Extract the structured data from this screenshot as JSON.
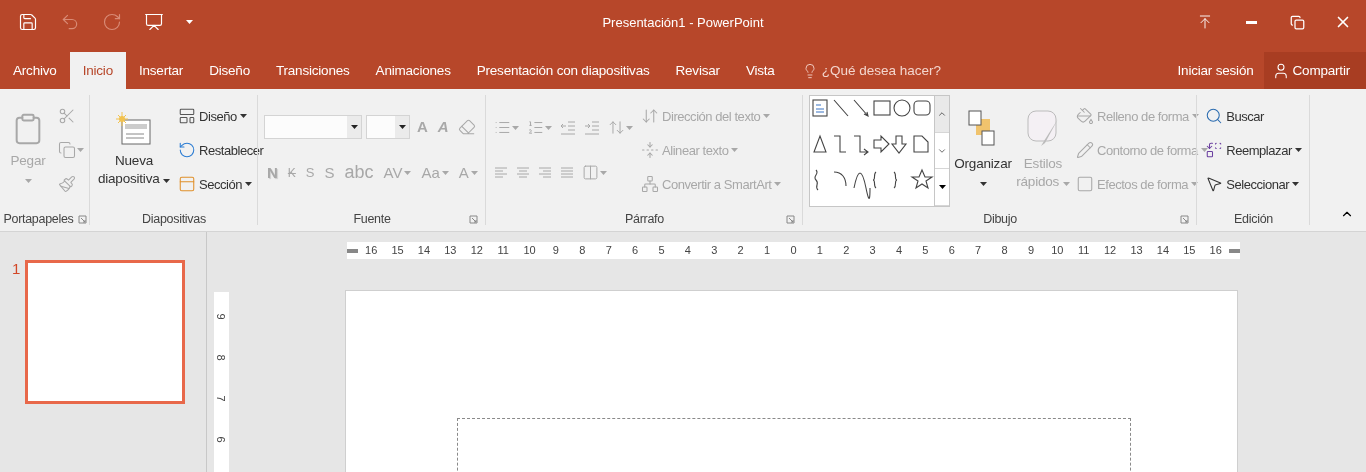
{
  "title_bar": {
    "title": "Presentación1 - PowerPoint",
    "quick_access": [
      {
        "disabled": false
      },
      {
        "disabled": true
      },
      {
        "disabled": true
      },
      {
        "disabled": false
      },
      {
        "disabled": false
      }
    ]
  },
  "menu_tabs": [
    {
      "label": "Archivo",
      "selected": false
    },
    {
      "label": "Inicio",
      "selected": true
    },
    {
      "label": "Insertar",
      "selected": false
    },
    {
      "label": "Diseño",
      "selected": false
    },
    {
      "label": "Transiciones",
      "selected": false
    },
    {
      "label": "Animaciones",
      "selected": false
    },
    {
      "label": "Presentación con diapositivas",
      "selected": false
    },
    {
      "label": "Revisar",
      "selected": false
    },
    {
      "label": "Vista",
      "selected": false
    }
  ],
  "tell_me": {
    "placeholder": "¿Qué desea hacer?"
  },
  "account": {
    "sign_in": "Iniciar sesión",
    "share": "Compartir"
  },
  "ribbon": {
    "groups": [
      {
        "kind": "clipboard",
        "name": "Portapapeles",
        "launcher": true,
        "columns": [
          [
            [
              {
                "kind": "large",
                "label": "Pegar",
                "dropdown": true,
                "disabled": true
              }
            ]
          ],
          [
            [
              {
                "kind": "icon",
                "dropdown": false,
                "disabled": true
              }
            ],
            [
              {
                "kind": "icon",
                "dropdown": true,
                "disabled": true
              }
            ],
            [
              {
                "kind": "icon",
                "dropdown": false,
                "disabled": true
              }
            ]
          ]
        ]
      },
      {
        "kind": "slides",
        "name": "Diapositivas",
        "launcher": false,
        "columns": [
          [
            [
              {
                "kind": "large",
                "label": "Nueva diapositiva",
                "dropdown": true,
                "disabled": false
              }
            ]
          ],
          [
            [
              {
                "kind": "small",
                "label": "Diseño",
                "dropdown": true,
                "disabled": false
              }
            ],
            [
              {
                "kind": "small",
                "label": "Restablecer",
                "dropdown": false,
                "disabled": false
              }
            ],
            [
              {
                "kind": "small",
                "label": "Sección",
                "dropdown": true,
                "disabled": false
              }
            ]
          ]
        ]
      },
      {
        "kind": "font",
        "name": "Fuente",
        "launcher": true,
        "columns": [
          [
            [
              {
                "kind": "combo",
                "dropdown": true,
                "disabled": true
              },
              {
                "kind": "combo",
                "dropdown": true,
                "disabled": true
              },
              {
                "kind": "glyph",
                "label": "A",
                "dropdown": false,
                "disabled": true
              },
              {
                "kind": "glyph",
                "label": "A",
                "dropdown": false,
                "disabled": true
              },
              {
                "kind": "icon",
                "dropdown": false,
                "disabled": true
              }
            ],
            [
              {
                "kind": "glyph",
                "label": "N",
                "dropdown": false,
                "disabled": true
              },
              {
                "kind": "glyph",
                "label": "K",
                "dropdown": false,
                "disabled": true
              },
              {
                "kind": "glyph",
                "label": "S",
                "dropdown": false,
                "disabled": true
              },
              {
                "kind": "glyph",
                "label": "S",
                "dropdown": false,
                "disabled": true
              },
              {
                "kind": "glyph",
                "label": "abc",
                "dropdown": false,
                "disabled": true
              },
              {
                "kind": "glyph",
                "label": "AV",
                "dropdown": true,
                "disabled": true
              },
              {
                "kind": "glyph",
                "label": "Aa",
                "dropdown": true,
                "disabled": true
              },
              {
                "kind": "glyph",
                "label": "A",
                "dropdown": true,
                "disabled": true
              }
            ]
          ]
        ]
      },
      {
        "kind": "paragraph",
        "name": "Párrafo",
        "launcher": true,
        "columns": [
          [
            [
              {
                "kind": "icon",
                "dropdown": true,
                "disabled": true
              },
              {
                "kind": "icon",
                "dropdown": true,
                "disabled": true
              },
              {
                "kind": "icon",
                "dropdown": false,
                "disabled": true
              },
              {
                "kind": "icon",
                "dropdown": false,
                "disabled": true
              },
              {
                "kind": "icon",
                "dropdown": true,
                "disabled": true
              }
            ],
            [
              {
                "kind": "icon",
                "dropdown": false,
                "disabled": true
              },
              {
                "kind": "icon",
                "dropdown": false,
                "disabled": true
              },
              {
                "kind": "icon",
                "dropdown": false,
                "disabled": true
              },
              {
                "kind": "icon",
                "dropdown": false,
                "disabled": true
              },
              {
                "kind": "icon",
                "dropdown": true,
                "disabled": true
              }
            ]
          ],
          [
            [
              {
                "kind": "small",
                "label": "Dirección del texto",
                "dropdown": true,
                "disabled": true
              }
            ],
            [
              {
                "kind": "small",
                "label": "Alinear texto",
                "dropdown": true,
                "disabled": true
              }
            ],
            [
              {
                "kind": "small",
                "label": "Convertir a SmartArt",
                "dropdown": true,
                "disabled": true
              }
            ]
          ]
        ]
      },
      {
        "kind": "drawing",
        "name": "Dibujo",
        "launcher": true,
        "columns": [
          [
            [
              {
                "kind": "gallery",
                "dropdown": true,
                "disabled": false
              }
            ]
          ],
          [
            [
              {
                "kind": "large",
                "label": "Organizar",
                "dropdown": true,
                "disabled": false
              }
            ]
          ],
          [
            [
              {
                "kind": "large",
                "label": "Estilos rápidos",
                "dropdown": true,
                "disabled": true
              }
            ]
          ],
          [
            [
              {
                "kind": "small",
                "label": "Relleno de forma",
                "dropdown": true,
                "disabled": true
              }
            ],
            [
              {
                "kind": "small",
                "label": "Contorno de forma",
                "dropdown": true,
                "disabled": true
              }
            ],
            [
              {
                "kind": "small",
                "label": "Efectos de forma",
                "dropdown": true,
                "disabled": true
              }
            ]
          ]
        ]
      },
      {
        "kind": "editing",
        "name": "Edición",
        "launcher": false,
        "columns": [
          [
            [
              {
                "kind": "small",
                "label": "Buscar",
                "dropdown": false,
                "disabled": false
              }
            ],
            [
              {
                "kind": "small",
                "label": "Reemplazar",
                "dropdown": true,
                "disabled": false
              }
            ],
            [
              {
                "kind": "small",
                "label": "Seleccionar",
                "dropdown": true,
                "disabled": false
              }
            ]
          ]
        ]
      }
    ]
  },
  "slides_pane": {
    "slides": [
      {
        "number": "1",
        "selected": true
      }
    ]
  },
  "rulers": {
    "horizontal": [
      "16",
      "15",
      "14",
      "13",
      "12",
      "11",
      "10",
      "9",
      "8",
      "7",
      "6",
      "5",
      "4",
      "3",
      "2",
      "1",
      "0",
      "1",
      "2",
      "3",
      "4",
      "5",
      "6",
      "7",
      "8",
      "9",
      "10",
      "11",
      "12",
      "13",
      "14",
      "15",
      "16"
    ],
    "vertical": [
      "9",
      "8",
      "7",
      "6"
    ]
  }
}
